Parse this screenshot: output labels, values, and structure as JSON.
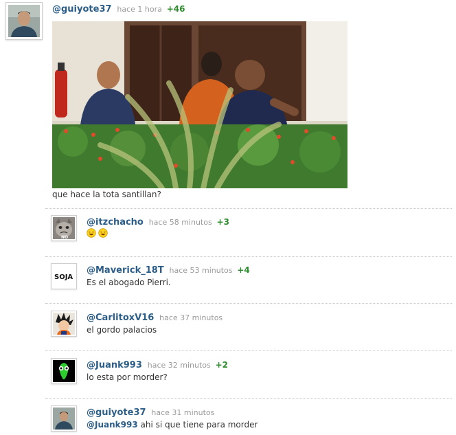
{
  "post": {
    "username": "@guiyote37",
    "time": "hace 1 hora",
    "votes": "+46",
    "text": "que hace la tota santillan?"
  },
  "comments": [
    {
      "username": "@itzchacho",
      "time": "hace 58 minutos",
      "votes": "+3",
      "text": "",
      "emoji_count": 2,
      "avatar": "grumpy-cat"
    },
    {
      "username": "@Maverick_18T",
      "time": "hace 53 minutos",
      "votes": "+4",
      "text": "Es el abogado Pierri.",
      "avatar": "soja-logo"
    },
    {
      "username": "@CarlitoxV16",
      "time": "hace 37 minutos",
      "votes": "",
      "text": "el gordo palacios",
      "avatar": "goku"
    },
    {
      "username": "@Juank993",
      "time": "hace 32 minutos",
      "votes": "+2",
      "text": "lo esta por morder?",
      "avatar": "green-alien"
    },
    {
      "username": "@guiyote37",
      "time": "hace 31 minutos",
      "votes": "",
      "mention": "@Juank993",
      "text": "ahi si que tiene para morder",
      "avatar": "man-photo"
    }
  ],
  "colors": {
    "username": "#2c5e88",
    "votes": "#2e8b2e",
    "time": "#999999"
  }
}
